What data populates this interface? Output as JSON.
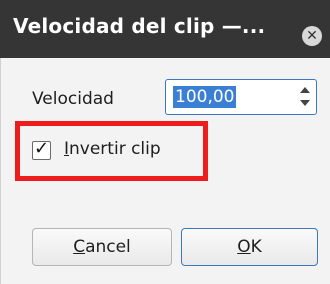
{
  "window": {
    "title": "Velocidad del clip —...",
    "close_icon": "close-circle-icon"
  },
  "form": {
    "speed_label": "Velocidad",
    "speed_value": "100,00",
    "reverse_label_prefix": "",
    "reverse_label_mnemonic": "I",
    "reverse_label_rest": "nvertir clip",
    "reverse_checked": true
  },
  "buttons": {
    "cancel_mnemonic": "C",
    "cancel_rest": "ancel",
    "ok_mnemonic": "O",
    "ok_rest": "K"
  },
  "colors": {
    "titlebar": "#353535",
    "selection": "#3b7fd4",
    "highlight": "#ef1c1c",
    "focus_border": "#3a78c2"
  }
}
